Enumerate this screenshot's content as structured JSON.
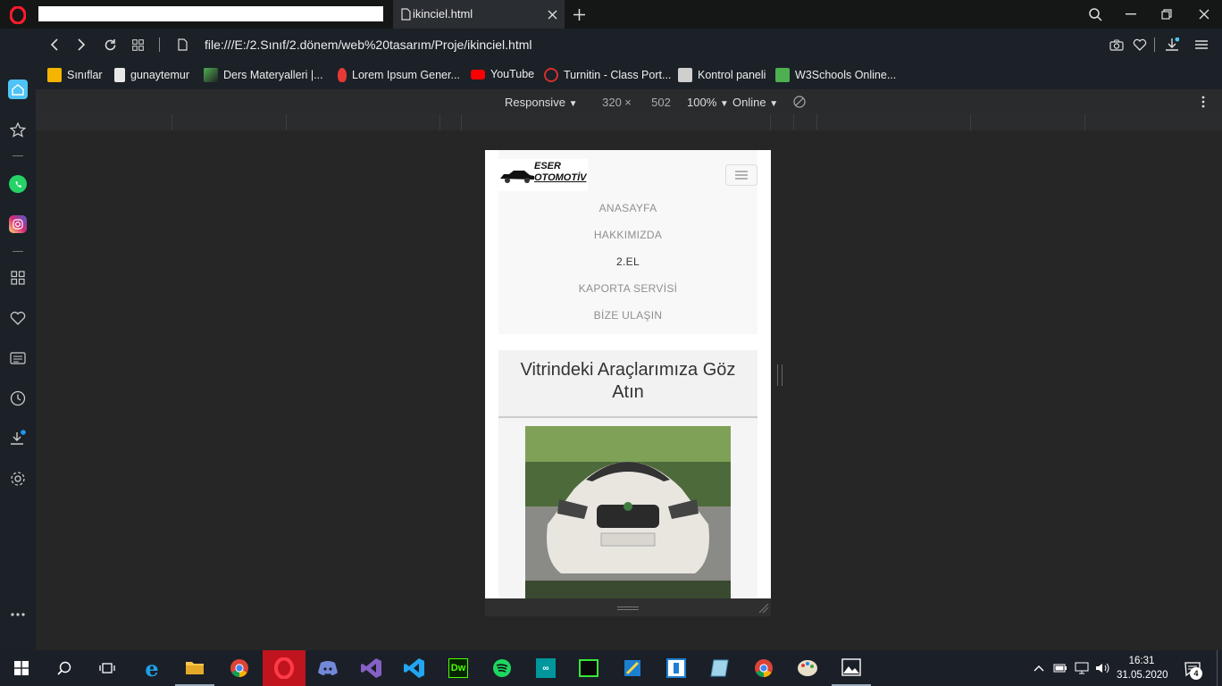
{
  "window": {
    "tab_title": "ikinciel.html",
    "url": "file:///E:/2.Sınıf/2.dönem/web%20tasarım/Proje/ikinciel.html"
  },
  "bookmarks": [
    {
      "label": "Sınıflar",
      "icon": "classroom-icon",
      "color": "#f4b400"
    },
    {
      "label": "gunaytemur",
      "icon": "page-icon",
      "color": "#e8e8e8"
    },
    {
      "label": "Ders Materyalleri |...",
      "icon": "materials-icon",
      "color": "#4caf50"
    },
    {
      "label": "Lorem Ipsum Gener...",
      "icon": "lorem-icon",
      "color": "#e53935"
    },
    {
      "label": "YouTube",
      "icon": "youtube-icon",
      "color": "#ff0000"
    },
    {
      "label": "Turnitin - Class Port...",
      "icon": "turnitin-icon",
      "color": "#d32f2f"
    },
    {
      "label": "Kontrol paneli",
      "icon": "control-panel-icon",
      "color": "#cfcfcf"
    },
    {
      "label": "W3Schools Online...",
      "icon": "w3schools-icon",
      "color": "#4caf50"
    }
  ],
  "devtools": {
    "mode": "Responsive",
    "width": "320",
    "times": "×",
    "height": "502",
    "zoom": "100%",
    "network": "Online"
  },
  "site": {
    "logo_line1": "ESER",
    "logo_line2": "OTOMOTİV",
    "nav": [
      "ANASAYFA",
      "HAKKIMIZDA",
      "2.EL",
      "KAPORTA SERVİSİ",
      "BİZE ULAŞIN"
    ],
    "active_nav": "2.EL",
    "heading": "Vitrindeki Araçlarımıza Göz Atın"
  },
  "taskbar": {
    "time": "16:31",
    "date": "31.05.2020",
    "notifications": "4"
  },
  "colors": {
    "accent": "#2196f3",
    "opera": "#ff1b2d"
  }
}
